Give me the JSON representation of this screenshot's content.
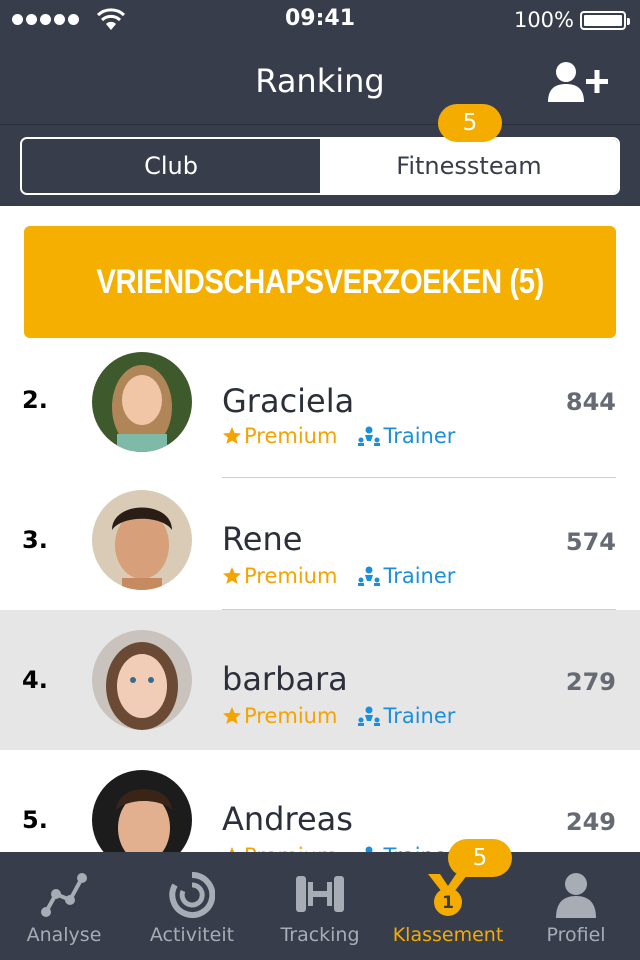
{
  "status_bar": {
    "time": "09:41",
    "battery": "100%"
  },
  "header": {
    "title": "Ranking",
    "segments": [
      {
        "label": "Club",
        "selected": true
      },
      {
        "label": "Fitnessteam",
        "selected": false,
        "badge": "5"
      }
    ]
  },
  "requests_button": {
    "label": "VRIENDSCHAPSVERZOEKEN (5)"
  },
  "ranking": [
    {
      "rank": "2.",
      "name": "Graciela",
      "score": "844",
      "premium": "Premium",
      "trainer": "Trainer"
    },
    {
      "rank": "3.",
      "name": "Rene",
      "score": "574",
      "premium": "Premium",
      "trainer": "Trainer"
    },
    {
      "rank": "4.",
      "name": "barbara",
      "score": "279",
      "premium": "Premium",
      "trainer": "Trainer",
      "highlighted": true
    },
    {
      "rank": "5.",
      "name": "Andreas",
      "score": "249",
      "premium": "Premium",
      "trainer": "Trainer"
    }
  ],
  "tabbar": {
    "tabs": [
      {
        "label": "Analyse",
        "icon": "analysis-icon"
      },
      {
        "label": "Activiteit",
        "icon": "activity-icon"
      },
      {
        "label": "Tracking",
        "icon": "dumbbell-icon"
      },
      {
        "label": "Klassement",
        "icon": "medal-icon",
        "active": true,
        "badge": "5",
        "medal_number": "1"
      },
      {
        "label": "Profiel",
        "icon": "profile-icon"
      }
    ]
  },
  "colors": {
    "header": "#373d4a",
    "accent": "#f5ac00",
    "trainer": "#1a8fdb",
    "highlight_row": "#e6e6e6"
  }
}
